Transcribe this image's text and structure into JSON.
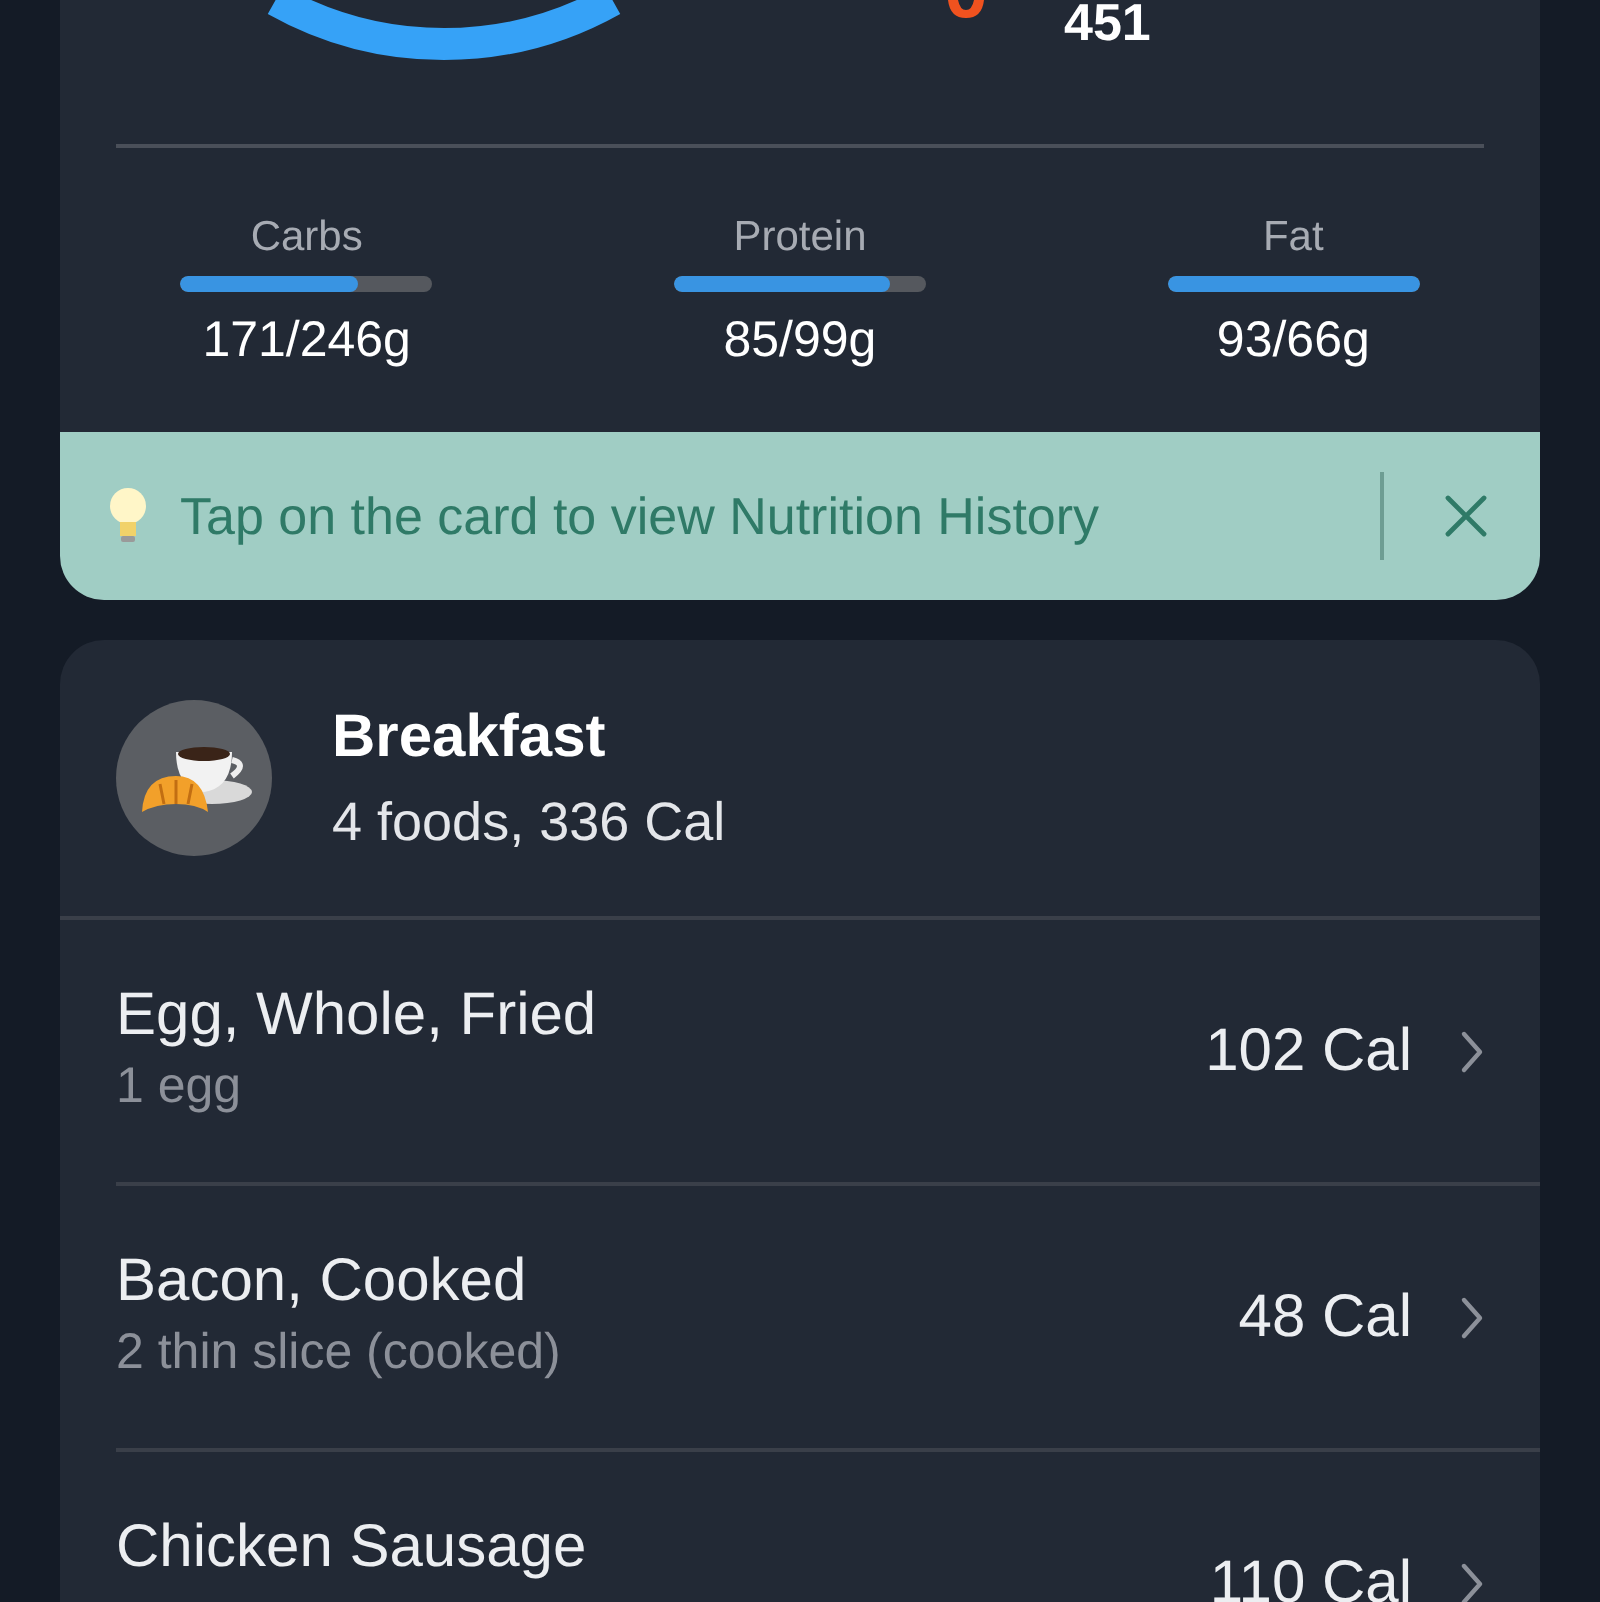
{
  "summary": {
    "calories_value": "451"
  },
  "macros": [
    {
      "label": "Carbs",
      "level": 0.7,
      "amount": "171/246g"
    },
    {
      "label": "Protein",
      "level": 0.86,
      "amount": "85/99g"
    },
    {
      "label": "Fat",
      "level": 1,
      "amount": "93/66g"
    }
  ],
  "tip": {
    "text": "Tap on the card to view Nutrition History"
  },
  "meal": {
    "title": "Breakfast",
    "subtitle": "4 foods, 336 Cal",
    "foods": [
      {
        "name": "Egg, Whole, Fried",
        "serving": "1 egg",
        "calories": "102 Cal"
      },
      {
        "name": "Bacon, Cooked",
        "serving": "2 thin slice (cooked)",
        "calories": "48 Cal"
      },
      {
        "name": "Chicken Sausage",
        "calories": "110 Cal"
      }
    ]
  }
}
